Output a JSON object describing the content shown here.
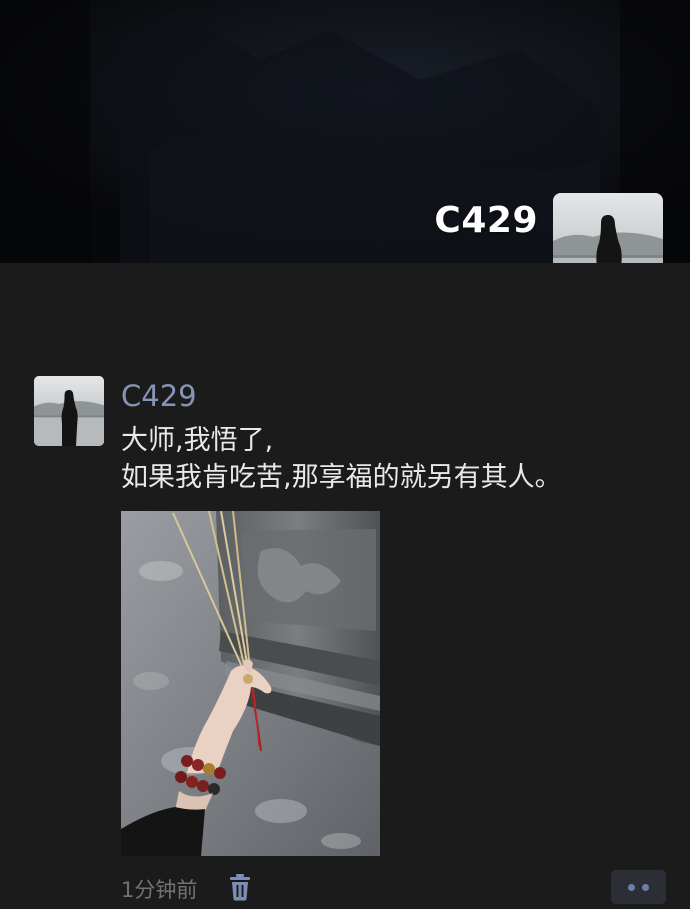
{
  "profile": {
    "name": "C429",
    "avatar_icon": "silhouette-by-lake-avatar"
  },
  "post": {
    "author": "C429",
    "lines": [
      "大师,我悟了,",
      "如果我肯吃苦,那享福的就另有其人。"
    ],
    "photo_icon": "hand-holding-incense-photo",
    "time": "1分钟前",
    "delete_icon": "trash-icon",
    "more_icon": "more-dots-icon"
  },
  "colors": {
    "background": "#1b1b1b",
    "author_name": "#8794b6",
    "text": "#e8e8e8",
    "timestamp": "#727272",
    "more_dot": "#6e7fa5"
  }
}
